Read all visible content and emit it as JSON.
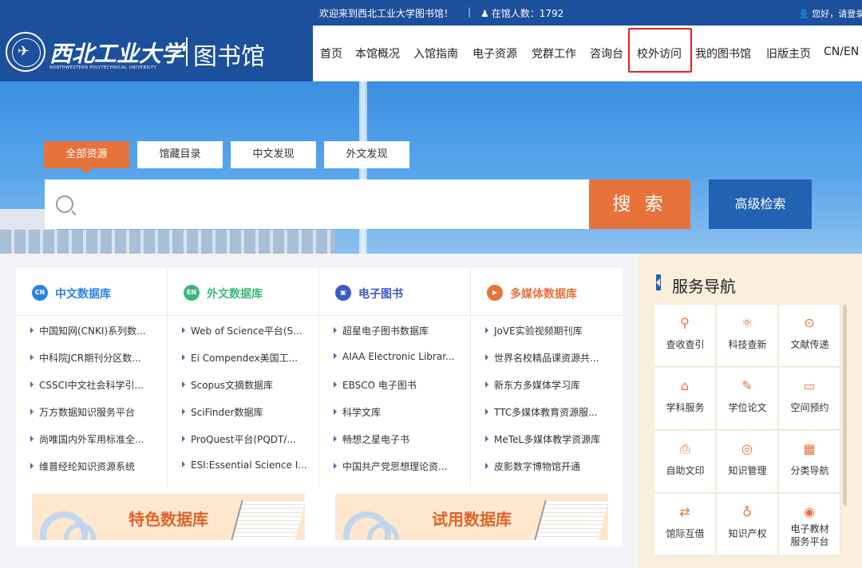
{
  "topbar": {
    "welcome": "欢迎来到西北工业大学图书馆！",
    "separator": "|",
    "online_label": "在馆人数：1792",
    "login": "您好，请登录"
  },
  "logo": {
    "cn_name": "西北工业大学",
    "en_name": "NORTHWESTERN POLYTECHNICAL UNIVERSITY",
    "library": "图书馆"
  },
  "nav": {
    "items": [
      "首页",
      "本馆概况",
      "入馆指南",
      "电子资源",
      "党群工作",
      "咨询台",
      "校外访问",
      "我的图书馆",
      "旧版主页",
      "CN/EN"
    ],
    "highlighted": "校外访问"
  },
  "search": {
    "tabs": [
      "全部资源",
      "馆藏目录",
      "中文发现",
      "外文发现"
    ],
    "active_tab": "全部资源",
    "placeholder": "",
    "search_button": "搜 索",
    "advanced_button": "高级检索"
  },
  "databases": {
    "columns": [
      {
        "icon_text": "CN",
        "icon_color": "#2a82e4",
        "title": "中文数据库",
        "title_color": "#2a82e4",
        "items": [
          "中国知网(CNKI)系列数...",
          "中科院JCR期刊分区数...",
          "CSSCI中文社会科学引...",
          "万方数据知识服务平台",
          "尚唯国内外军用标准全...",
          "维普经纶知识资源系统"
        ]
      },
      {
        "icon_text": "EN",
        "icon_color": "#3cb878",
        "title": "外文数据库",
        "title_color": "#3cb878",
        "items": [
          "Web of Science平台(S...",
          "Ei Compendex美国工...",
          "Scopus文摘数据库",
          "SciFinder数据库",
          "ProQuest平台(PQDT/...",
          "ESI:Essential Science I..."
        ]
      },
      {
        "icon_text": "▣",
        "icon_color": "#3a5bc7",
        "title": "电子图书",
        "title_color": "#3a5bc7",
        "items": [
          "超星电子图书数据库",
          "AIAA Electronic Librar...",
          "EBSCO 电子图书",
          "科学文库",
          "畅想之星电子书",
          "中国共产党思想理论资..."
        ]
      },
      {
        "icon_text": "▶",
        "icon_color": "#e8733a",
        "title": "多媒体数据库",
        "title_color": "#e8733a",
        "items": [
          "JoVE实验视频期刊库",
          "世界名校精品课资源共...",
          "新东方多媒体学习库",
          "TTC多媒体教育资源服...",
          "MeTeL多媒体教学资源库",
          "皮影数字博物馆开通"
        ]
      }
    ],
    "banners": [
      "特色数据库",
      "试用数据库"
    ]
  },
  "services": {
    "title": "服务导航",
    "items": [
      {
        "label": "查收查引",
        "icon": "search-hand-icon",
        "glyph": "⚲"
      },
      {
        "label": "科技查新",
        "icon": "atom-icon",
        "glyph": "⚛"
      },
      {
        "label": "文献传递",
        "icon": "transfer-icon",
        "glyph": "⊙"
      },
      {
        "label": "学科服务",
        "icon": "graduation-cap-icon",
        "glyph": "⌂"
      },
      {
        "label": "学位论文",
        "icon": "document-edit-icon",
        "glyph": "✎"
      },
      {
        "label": "空间预约",
        "icon": "seat-icon",
        "glyph": "▭"
      },
      {
        "label": "自助文印",
        "icon": "printer-icon",
        "glyph": "⎙"
      },
      {
        "label": "知识管理",
        "icon": "knowledge-icon",
        "glyph": "◎"
      },
      {
        "label": "分类导航",
        "icon": "grid-icon",
        "glyph": "▦"
      },
      {
        "label": "馆际互借",
        "icon": "exchange-icon",
        "glyph": "⇄"
      },
      {
        "label": "知识产权",
        "icon": "ip-icon",
        "glyph": "♁"
      },
      {
        "label": "电子教材服务平台",
        "icon": "e-textbook-icon",
        "glyph": "◉"
      }
    ]
  }
}
